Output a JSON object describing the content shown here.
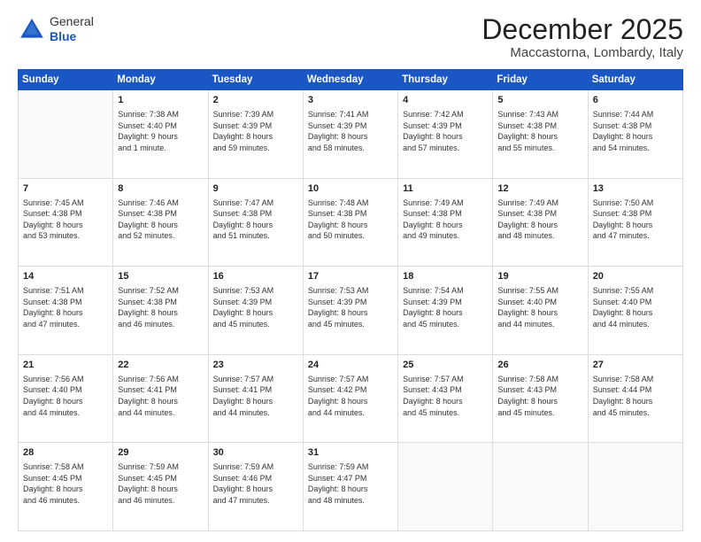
{
  "header": {
    "logo_general": "General",
    "logo_blue": "Blue",
    "title": "December 2025",
    "location": "Maccastorna, Lombardy, Italy"
  },
  "days_of_week": [
    "Sunday",
    "Monday",
    "Tuesday",
    "Wednesday",
    "Thursday",
    "Friday",
    "Saturday"
  ],
  "weeks": [
    [
      {
        "day": "",
        "info": ""
      },
      {
        "day": "1",
        "info": "Sunrise: 7:38 AM\nSunset: 4:40 PM\nDaylight: 9 hours\nand 1 minute."
      },
      {
        "day": "2",
        "info": "Sunrise: 7:39 AM\nSunset: 4:39 PM\nDaylight: 8 hours\nand 59 minutes."
      },
      {
        "day": "3",
        "info": "Sunrise: 7:41 AM\nSunset: 4:39 PM\nDaylight: 8 hours\nand 58 minutes."
      },
      {
        "day": "4",
        "info": "Sunrise: 7:42 AM\nSunset: 4:39 PM\nDaylight: 8 hours\nand 57 minutes."
      },
      {
        "day": "5",
        "info": "Sunrise: 7:43 AM\nSunset: 4:38 PM\nDaylight: 8 hours\nand 55 minutes."
      },
      {
        "day": "6",
        "info": "Sunrise: 7:44 AM\nSunset: 4:38 PM\nDaylight: 8 hours\nand 54 minutes."
      }
    ],
    [
      {
        "day": "7",
        "info": "Sunrise: 7:45 AM\nSunset: 4:38 PM\nDaylight: 8 hours\nand 53 minutes."
      },
      {
        "day": "8",
        "info": "Sunrise: 7:46 AM\nSunset: 4:38 PM\nDaylight: 8 hours\nand 52 minutes."
      },
      {
        "day": "9",
        "info": "Sunrise: 7:47 AM\nSunset: 4:38 PM\nDaylight: 8 hours\nand 51 minutes."
      },
      {
        "day": "10",
        "info": "Sunrise: 7:48 AM\nSunset: 4:38 PM\nDaylight: 8 hours\nand 50 minutes."
      },
      {
        "day": "11",
        "info": "Sunrise: 7:49 AM\nSunset: 4:38 PM\nDaylight: 8 hours\nand 49 minutes."
      },
      {
        "day": "12",
        "info": "Sunrise: 7:49 AM\nSunset: 4:38 PM\nDaylight: 8 hours\nand 48 minutes."
      },
      {
        "day": "13",
        "info": "Sunrise: 7:50 AM\nSunset: 4:38 PM\nDaylight: 8 hours\nand 47 minutes."
      }
    ],
    [
      {
        "day": "14",
        "info": "Sunrise: 7:51 AM\nSunset: 4:38 PM\nDaylight: 8 hours\nand 47 minutes."
      },
      {
        "day": "15",
        "info": "Sunrise: 7:52 AM\nSunset: 4:38 PM\nDaylight: 8 hours\nand 46 minutes."
      },
      {
        "day": "16",
        "info": "Sunrise: 7:53 AM\nSunset: 4:39 PM\nDaylight: 8 hours\nand 45 minutes."
      },
      {
        "day": "17",
        "info": "Sunrise: 7:53 AM\nSunset: 4:39 PM\nDaylight: 8 hours\nand 45 minutes."
      },
      {
        "day": "18",
        "info": "Sunrise: 7:54 AM\nSunset: 4:39 PM\nDaylight: 8 hours\nand 45 minutes."
      },
      {
        "day": "19",
        "info": "Sunrise: 7:55 AM\nSunset: 4:40 PM\nDaylight: 8 hours\nand 44 minutes."
      },
      {
        "day": "20",
        "info": "Sunrise: 7:55 AM\nSunset: 4:40 PM\nDaylight: 8 hours\nand 44 minutes."
      }
    ],
    [
      {
        "day": "21",
        "info": "Sunrise: 7:56 AM\nSunset: 4:40 PM\nDaylight: 8 hours\nand 44 minutes."
      },
      {
        "day": "22",
        "info": "Sunrise: 7:56 AM\nSunset: 4:41 PM\nDaylight: 8 hours\nand 44 minutes."
      },
      {
        "day": "23",
        "info": "Sunrise: 7:57 AM\nSunset: 4:41 PM\nDaylight: 8 hours\nand 44 minutes."
      },
      {
        "day": "24",
        "info": "Sunrise: 7:57 AM\nSunset: 4:42 PM\nDaylight: 8 hours\nand 44 minutes."
      },
      {
        "day": "25",
        "info": "Sunrise: 7:57 AM\nSunset: 4:43 PM\nDaylight: 8 hours\nand 45 minutes."
      },
      {
        "day": "26",
        "info": "Sunrise: 7:58 AM\nSunset: 4:43 PM\nDaylight: 8 hours\nand 45 minutes."
      },
      {
        "day": "27",
        "info": "Sunrise: 7:58 AM\nSunset: 4:44 PM\nDaylight: 8 hours\nand 45 minutes."
      }
    ],
    [
      {
        "day": "28",
        "info": "Sunrise: 7:58 AM\nSunset: 4:45 PM\nDaylight: 8 hours\nand 46 minutes."
      },
      {
        "day": "29",
        "info": "Sunrise: 7:59 AM\nSunset: 4:45 PM\nDaylight: 8 hours\nand 46 minutes."
      },
      {
        "day": "30",
        "info": "Sunrise: 7:59 AM\nSunset: 4:46 PM\nDaylight: 8 hours\nand 47 minutes."
      },
      {
        "day": "31",
        "info": "Sunrise: 7:59 AM\nSunset: 4:47 PM\nDaylight: 8 hours\nand 48 minutes."
      },
      {
        "day": "",
        "info": ""
      },
      {
        "day": "",
        "info": ""
      },
      {
        "day": "",
        "info": ""
      }
    ]
  ]
}
